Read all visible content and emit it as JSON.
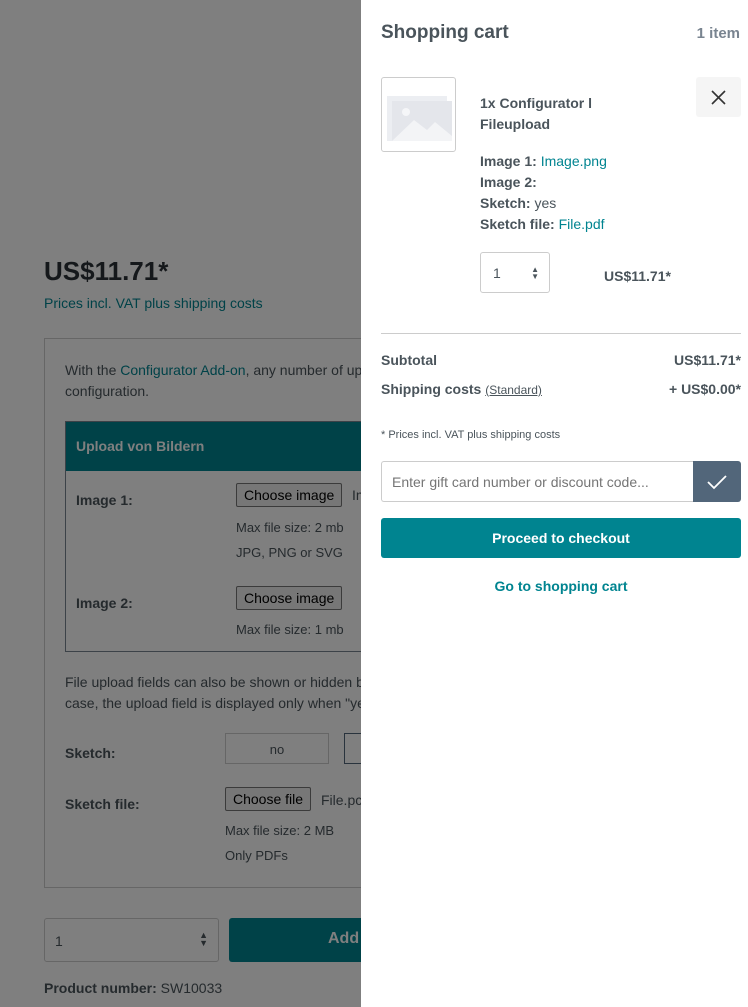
{
  "product": {
    "price": "US$11.71*",
    "vat_note": "Prices incl. VAT plus shipping costs",
    "intro_pre": "With the ",
    "intro_link": "Configurator Add-on",
    "intro_post": ", any number of up",
    "intro_line2": "configuration.",
    "upload_header": "Upload von Bildern",
    "image1_label": "Image 1:",
    "choose_image": "Choose image",
    "image1_file": "Im",
    "image1_max": "Max file size: 2 mb",
    "image1_types": "JPG, PNG or SVG",
    "image2_label": "Image 2:",
    "image2_max": "Max file size: 1 mb",
    "para_line1": "File upload fields can also be shown or hidden b",
    "para_line2": "case, the upload field is displayed only when \"ye",
    "sketch_label": "Sketch:",
    "sketch_no": "no",
    "sketch_file_label": "Sketch file:",
    "choose_file": "Choose file",
    "sketch_file": "File.pc",
    "sketch_max": "Max file size: 2 MB",
    "sketch_types": "Only PDFs",
    "quantity": "1",
    "add_button": "Add",
    "product_number_label": "Product number:",
    "product_number": " SW10033"
  },
  "cart": {
    "title": "Shopping cart",
    "count": "1 item",
    "item": {
      "name": "1x Configurator l Fileupload",
      "options": [
        {
          "label": "Image 1:",
          "value": "Image.png",
          "link": true
        },
        {
          "label": "Image 2:",
          "value": "",
          "link": false
        },
        {
          "label": "Sketch:",
          "value": "yes",
          "link": false
        },
        {
          "label": "Sketch file:",
          "value": "File.pdf",
          "link": true
        }
      ],
      "quantity": "1",
      "price": "US$11.71*"
    },
    "subtotal_label": "Subtotal",
    "subtotal": "US$11.71*",
    "shipping_label": "Shipping costs",
    "shipping_method": "(Standard)",
    "shipping": "+ US$0.00*",
    "note": "* Prices incl. VAT plus shipping costs",
    "discount_placeholder": "Enter gift card number or discount code...",
    "checkout": "Proceed to checkout",
    "go_to_cart": "Go to shopping cart"
  },
  "colors": {
    "accent": "#008490",
    "overlay": "rgba(0,0,0,0.5)"
  }
}
